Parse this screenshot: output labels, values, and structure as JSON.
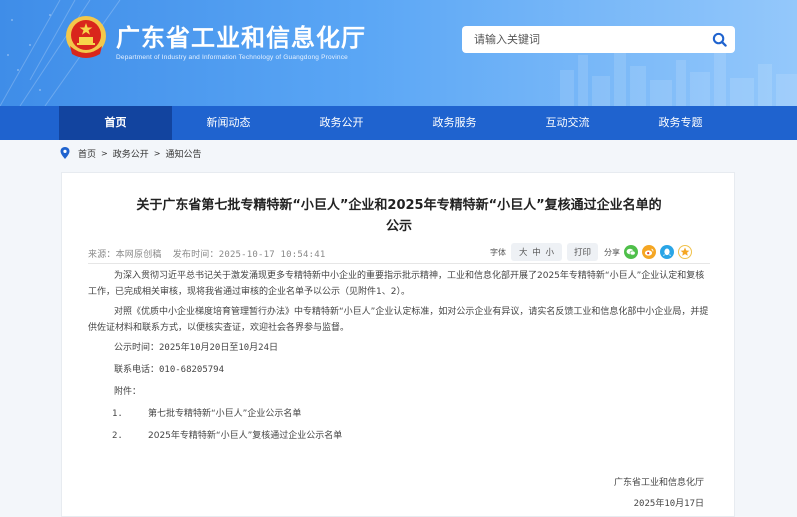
{
  "header": {
    "site_title": "广东省工业和信息化厅",
    "site_subtitle": "Department of Industry and Information Technology of Guangdong Province",
    "search_placeholder": "请输入关键词",
    "emblem_icon": "national-emblem-icon",
    "search_icon": "search-icon"
  },
  "nav": {
    "items": [
      {
        "label": "首页",
        "active": true
      },
      {
        "label": "新闻动态"
      },
      {
        "label": "政务公开"
      },
      {
        "label": "政务服务"
      },
      {
        "label": "互动交流"
      },
      {
        "label": "政务专题"
      }
    ]
  },
  "breadcrumb": {
    "items": [
      "首页",
      "政务公开",
      "通知公告"
    ],
    "separator": ">"
  },
  "article": {
    "title_line1": "关于广东省第七批专精特新“小巨人”企业和2025年专精特新“小巨人”复核通过企业名单的",
    "title_line2": "公示",
    "source_label": "来源：",
    "source": "本网原创稿",
    "time_label": "发布时间：",
    "time": "2025-10-17 10:54:41",
    "font_label": "字体",
    "font_sizes": [
      "大",
      "中",
      "小"
    ],
    "print_label": "打印",
    "share_label": "分享",
    "paragraph1": "为深入贯彻习近平总书记关于激发涌现更多专精特新中小企业的重要指示批示精神，工业和信息化部开展了2025年专精特新“小巨人”企业认定和复核工作，已完成相关审核，现将我省通过审核的企业名单予以公示（见附件1、2）。",
    "paragraph2": "对照《优质中小企业梯度培育管理暂行办法》中专精特新“小巨人”企业认定标准，如对公示企业有异议，请实名反馈工业和信息化部中小企业局，并提供佐证材料和联系方式，以便核实查证，欢迎社会各界参与监督。",
    "period": "公示时间：2025年10月20日至10月24日",
    "phone": "联系电话：010-68205794",
    "attachments_label": "附件：",
    "attachments": [
      {
        "num": "1.",
        "name": "第七批专精特新“小巨人”企业公示名单"
      },
      {
        "num": "2.",
        "name": "2025年专精特新“小巨人”复核通过企业公示名单"
      }
    ],
    "signature": "广东省工业和信息化厅",
    "date": "2025年10月17日"
  },
  "colors": {
    "nav_bg": "#1f63cf",
    "nav_active": "#12449f",
    "banner": "#5aa6f5"
  }
}
